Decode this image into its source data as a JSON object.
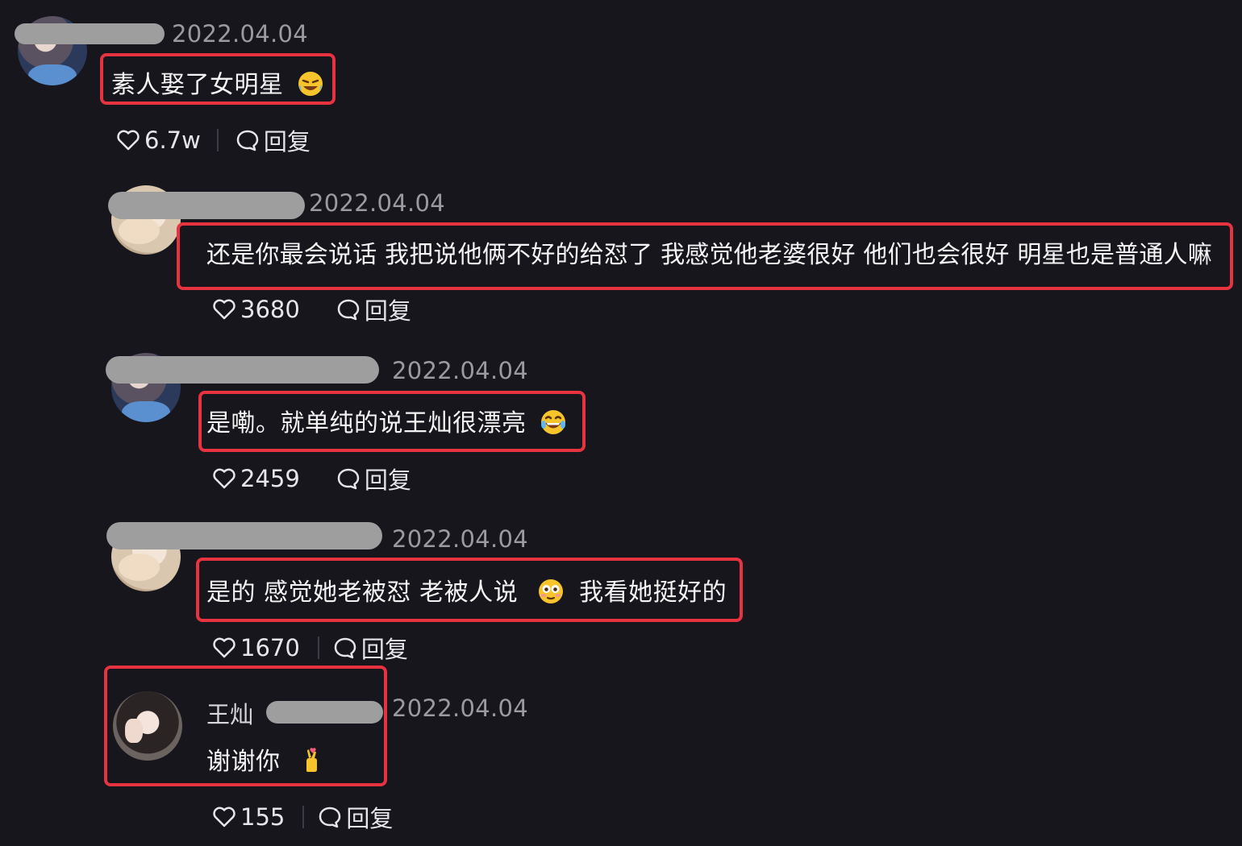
{
  "comments": [
    {
      "date": "2022.04.04",
      "text": "素人娶了女明星",
      "emoji": "rofl-emoji",
      "likes": "6.7w",
      "reply_label": "回复"
    },
    {
      "date": "2022.04.04",
      "text": "还是你最会说话 我把说他俩不好的给怼了 我感觉他老婆很好 他们也会很好 明星也是普通人嘛",
      "likes": "3680",
      "reply_label": "回复"
    },
    {
      "date": "2022.04.04",
      "text": "是嘞。就单纯的说王灿很漂亮",
      "emoji": "tears-of-joy-emoji",
      "likes": "2459",
      "reply_label": "回复"
    },
    {
      "date": "2022.04.04",
      "text_before": "是的 感觉她老被怼 老被人说",
      "emoji": "flushed-emoji",
      "text_after": "我看她挺好的",
      "likes": "1670",
      "reply_label": "回复"
    },
    {
      "username": "王灿",
      "date": "2022.04.04",
      "text": "谢谢你",
      "emoji": "finger-heart-emoji",
      "likes": "155",
      "reply_label": "回复"
    }
  ],
  "colors": {
    "background": "#16161c",
    "highlight_border": "#e6333f",
    "muted_text": "#9a9aa0",
    "name_mask": "#9e9e9e"
  }
}
